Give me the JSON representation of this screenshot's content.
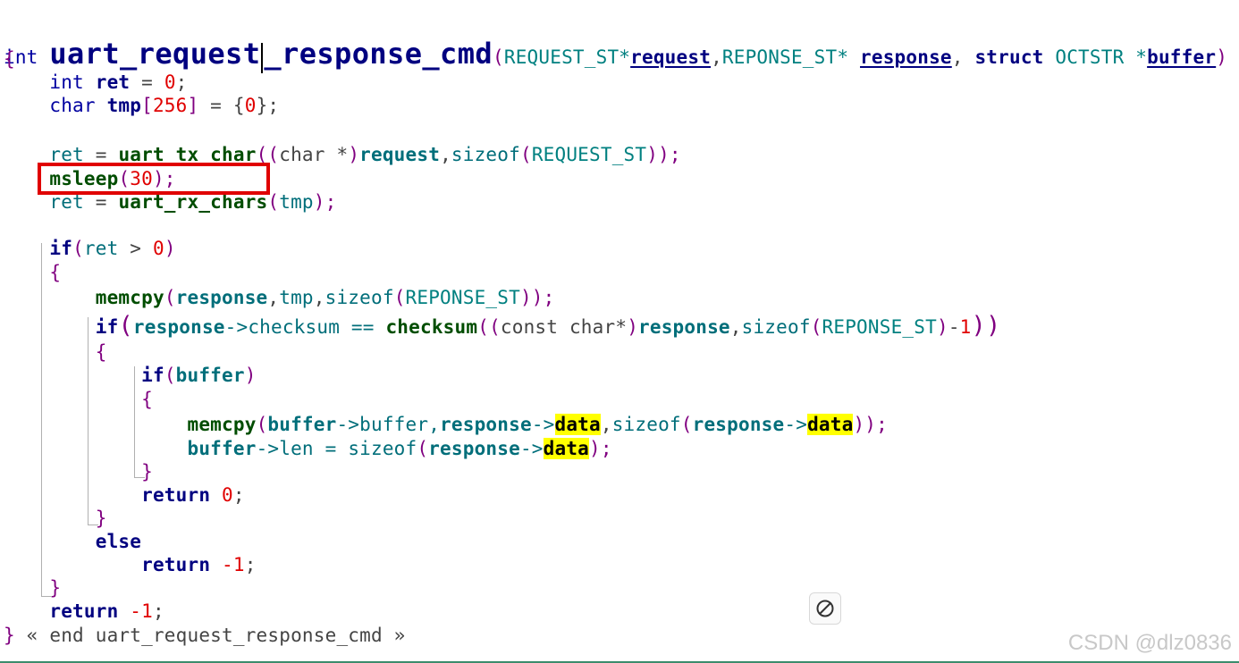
{
  "signature": {
    "ret_type": "int",
    "name_a": "uart_request",
    "name_b": "_response_cmd",
    "open_paren": "(",
    "p1_type": "REQUEST_ST*",
    "p1_name": "request",
    "comma1": ",",
    "p2_type": "REPONSE_ST* ",
    "p2_name": "response",
    "comma2": ", ",
    "p3_kw": "struct",
    "p3_type": " OCTSTR *",
    "p3_name": "buffer",
    "close_paren": ")"
  },
  "code": {
    "open_brace": "{",
    "l_int": "int",
    "l_ret": "ret",
    "l_eq0": " = ",
    "l_zero": "0",
    "l_semi": ";",
    "l_char": "char",
    "l_tmp": "tmp",
    "l_arr_open": "[",
    "l_256": "256",
    "l_arr_close": "]",
    "l_init_a": " = {",
    "l_init_zero": "0",
    "l_init_b": "};",
    "tx_ret": "ret",
    "tx_eq": " = ",
    "tx_fn": "uart_tx_char",
    "tx_p1": "(",
    "tx_p2": "(",
    "tx_cast": "char *",
    "tx_p3": ")",
    "tx_req": "request",
    "tx_comma": ",",
    "tx_sizeof": "sizeof",
    "tx_p4": "(",
    "tx_type": "REQUEST_ST",
    "tx_p5": "));",
    "ms_fn": "msleep",
    "ms_open": "(",
    "ms_num": "30",
    "ms_close": ");",
    "rx_ret": "ret",
    "rx_eq": " = ",
    "rx_fn": "uart_rx_chars",
    "rx_open": "(",
    "rx_arg": "tmp",
    "rx_close": ");",
    "if1_kw": "if",
    "if1_open": "(",
    "if1_ret": "ret",
    "if1_op": " > ",
    "if1_zero": "0",
    "if1_close": ")",
    "brace1_open": "{",
    "mc1_fn": "memcpy",
    "mc1_open": "(",
    "mc1_resp": "response",
    "mc1_comma1": ",",
    "mc1_tmp": "tmp",
    "mc1_comma2": ",",
    "mc1_sizeof": "sizeof",
    "mc1_p": "(",
    "mc1_type": "REPONSE_ST",
    "mc1_close": "));",
    "if2_kw": "if",
    "if2_open": "(",
    "if2_resp": "response",
    "if2_arrow": "->checksum == ",
    "if2_fn": "checksum",
    "if2_p1": "(",
    "if2_p2": "(",
    "if2_cast": "const char*",
    "if2_p3": ")",
    "if2_resp2": "response",
    "if2_comma": ",",
    "if2_sizeof": "sizeof",
    "if2_p4": "(",
    "if2_type": "REPONSE_ST",
    "if2_p5": ")",
    "if2_minus": "-",
    "if2_one": "1",
    "if2_close": "))",
    "brace2_open": "{",
    "if3_kw": "if",
    "if3_open": "(",
    "if3_buf": "buffer",
    "if3_close": ")",
    "brace3_open": "{",
    "mc2_fn": "memcpy",
    "mc2_open": "(",
    "mc2_buf": "buffer",
    "mc2_arrow1": "->buffer,",
    "mc2_resp": "response",
    "mc2_arrow2": "->",
    "mc2_data": "data",
    "mc2_comma": ",",
    "mc2_sizeof": "sizeof",
    "mc2_p": "(",
    "mc2_resp2": "response",
    "mc2_arrow3": "->",
    "mc2_data2": "data",
    "mc2_close": "));",
    "len_buf": "buffer",
    "len_arrow": "->len = ",
    "len_sizeof": "sizeof",
    "len_p": "(",
    "len_resp": "response",
    "len_arrow2": "->",
    "len_data": "data",
    "len_close": ");",
    "brace3_close": "}",
    "ret0_kw": "return",
    "ret0_sp": " ",
    "ret0_num": "0",
    "ret0_semi": ";",
    "brace2_close": "}",
    "else_kw": "else",
    "retm1a_kw": "return",
    "retm1a_sp": " ",
    "retm1a_num": "-1",
    "retm1a_semi": ";",
    "brace1_close": "}",
    "retm1b_kw": "return",
    "retm1b_sp": " ",
    "retm1b_num": "-1",
    "retm1b_semi": ";",
    "close_brace": "}",
    "end_comment": " « end uart_request_response_cmd »"
  },
  "watermark": "CSDN @dlz0836",
  "icons": {
    "fold": "circle-slash-icon"
  },
  "colors": {
    "highlight": "#ffff00",
    "box": "#e00000"
  }
}
